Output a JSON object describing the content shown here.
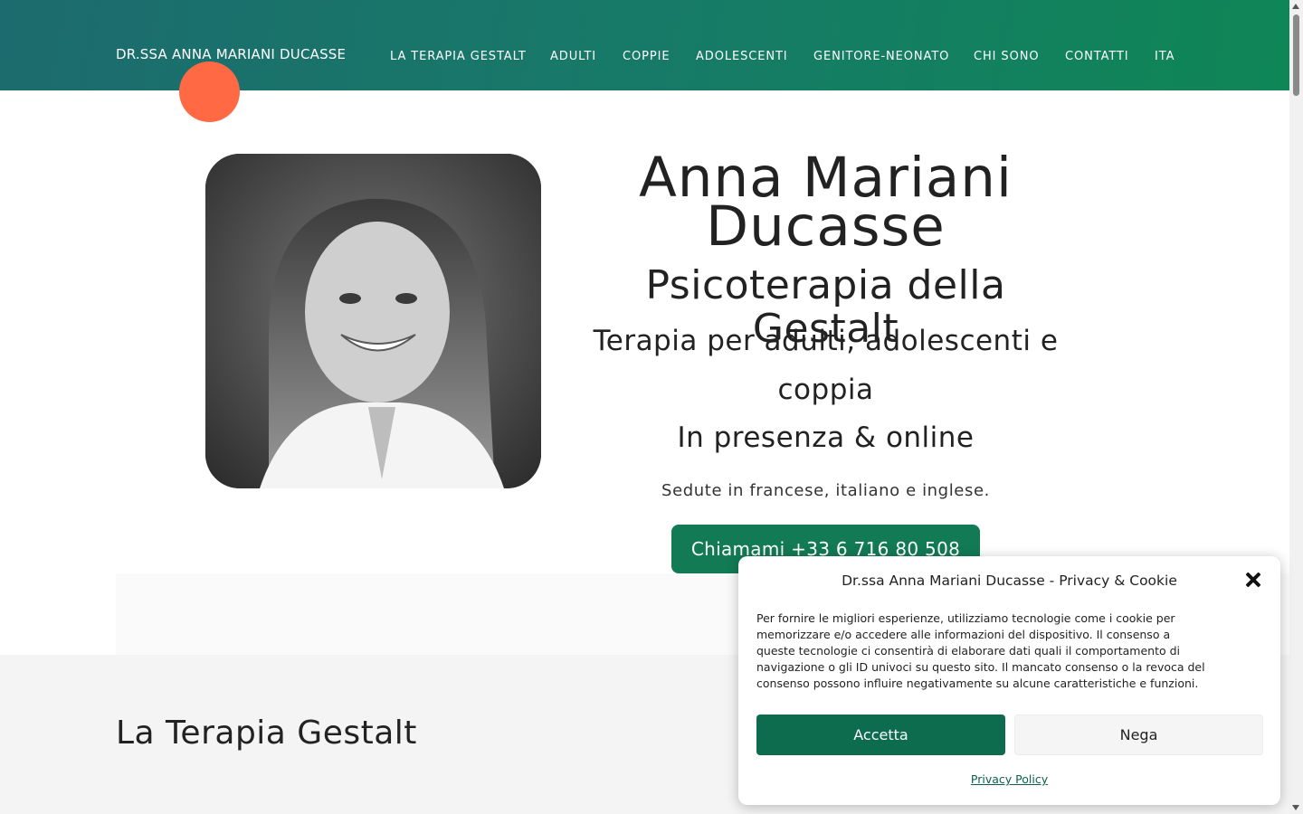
{
  "header": {
    "brand": "DR.SSA ANNA MARIANI DUCASSE",
    "nav": [
      {
        "label": "LA TERAPIA GESTALT"
      },
      {
        "label": "ADULTI"
      },
      {
        "label": "COPPIE"
      },
      {
        "label": "ADOLESCENTI"
      },
      {
        "label": "GENITORE-NEONATO"
      },
      {
        "label": "CHI SONO"
      },
      {
        "label": "CONTATTI"
      },
      {
        "label": "ITA"
      }
    ]
  },
  "hero": {
    "name": "Anna Mariani Ducasse",
    "subtitle": "Psicoterapia della Gestalt",
    "tagline": "Terapia per adulti, adolescenti e coppia",
    "modes": "In presenza & online",
    "languages": "Sedute in francese, italiano e inglese.",
    "cta": "Chiamami +33 6 716 80 508"
  },
  "section": {
    "title": "La Terapia Gestalt"
  },
  "cookie": {
    "title": "Dr.ssa Anna Mariani Ducasse - Privacy & Cookie",
    "text": "Per fornire le migliori esperienze, utilizziamo tecnologie come i cookie per memorizzare e/o accedere alle informazioni del dispositivo. Il consenso a queste tecnologie ci consentirà di elaborare dati quali il comportamento di navigazione o gli ID univoci su questo sito. Il mancato consenso o la revoca del consenso possono influire negativamente su alcune caratteristiche e funzioni.",
    "accept": "Accetta",
    "deny": "Nega",
    "privacy": "Privacy Policy"
  },
  "colors": {
    "accent": "#137a56",
    "header_start": "#1c6b6e",
    "header_end": "#0f8656",
    "dot": "#ff6a44"
  }
}
